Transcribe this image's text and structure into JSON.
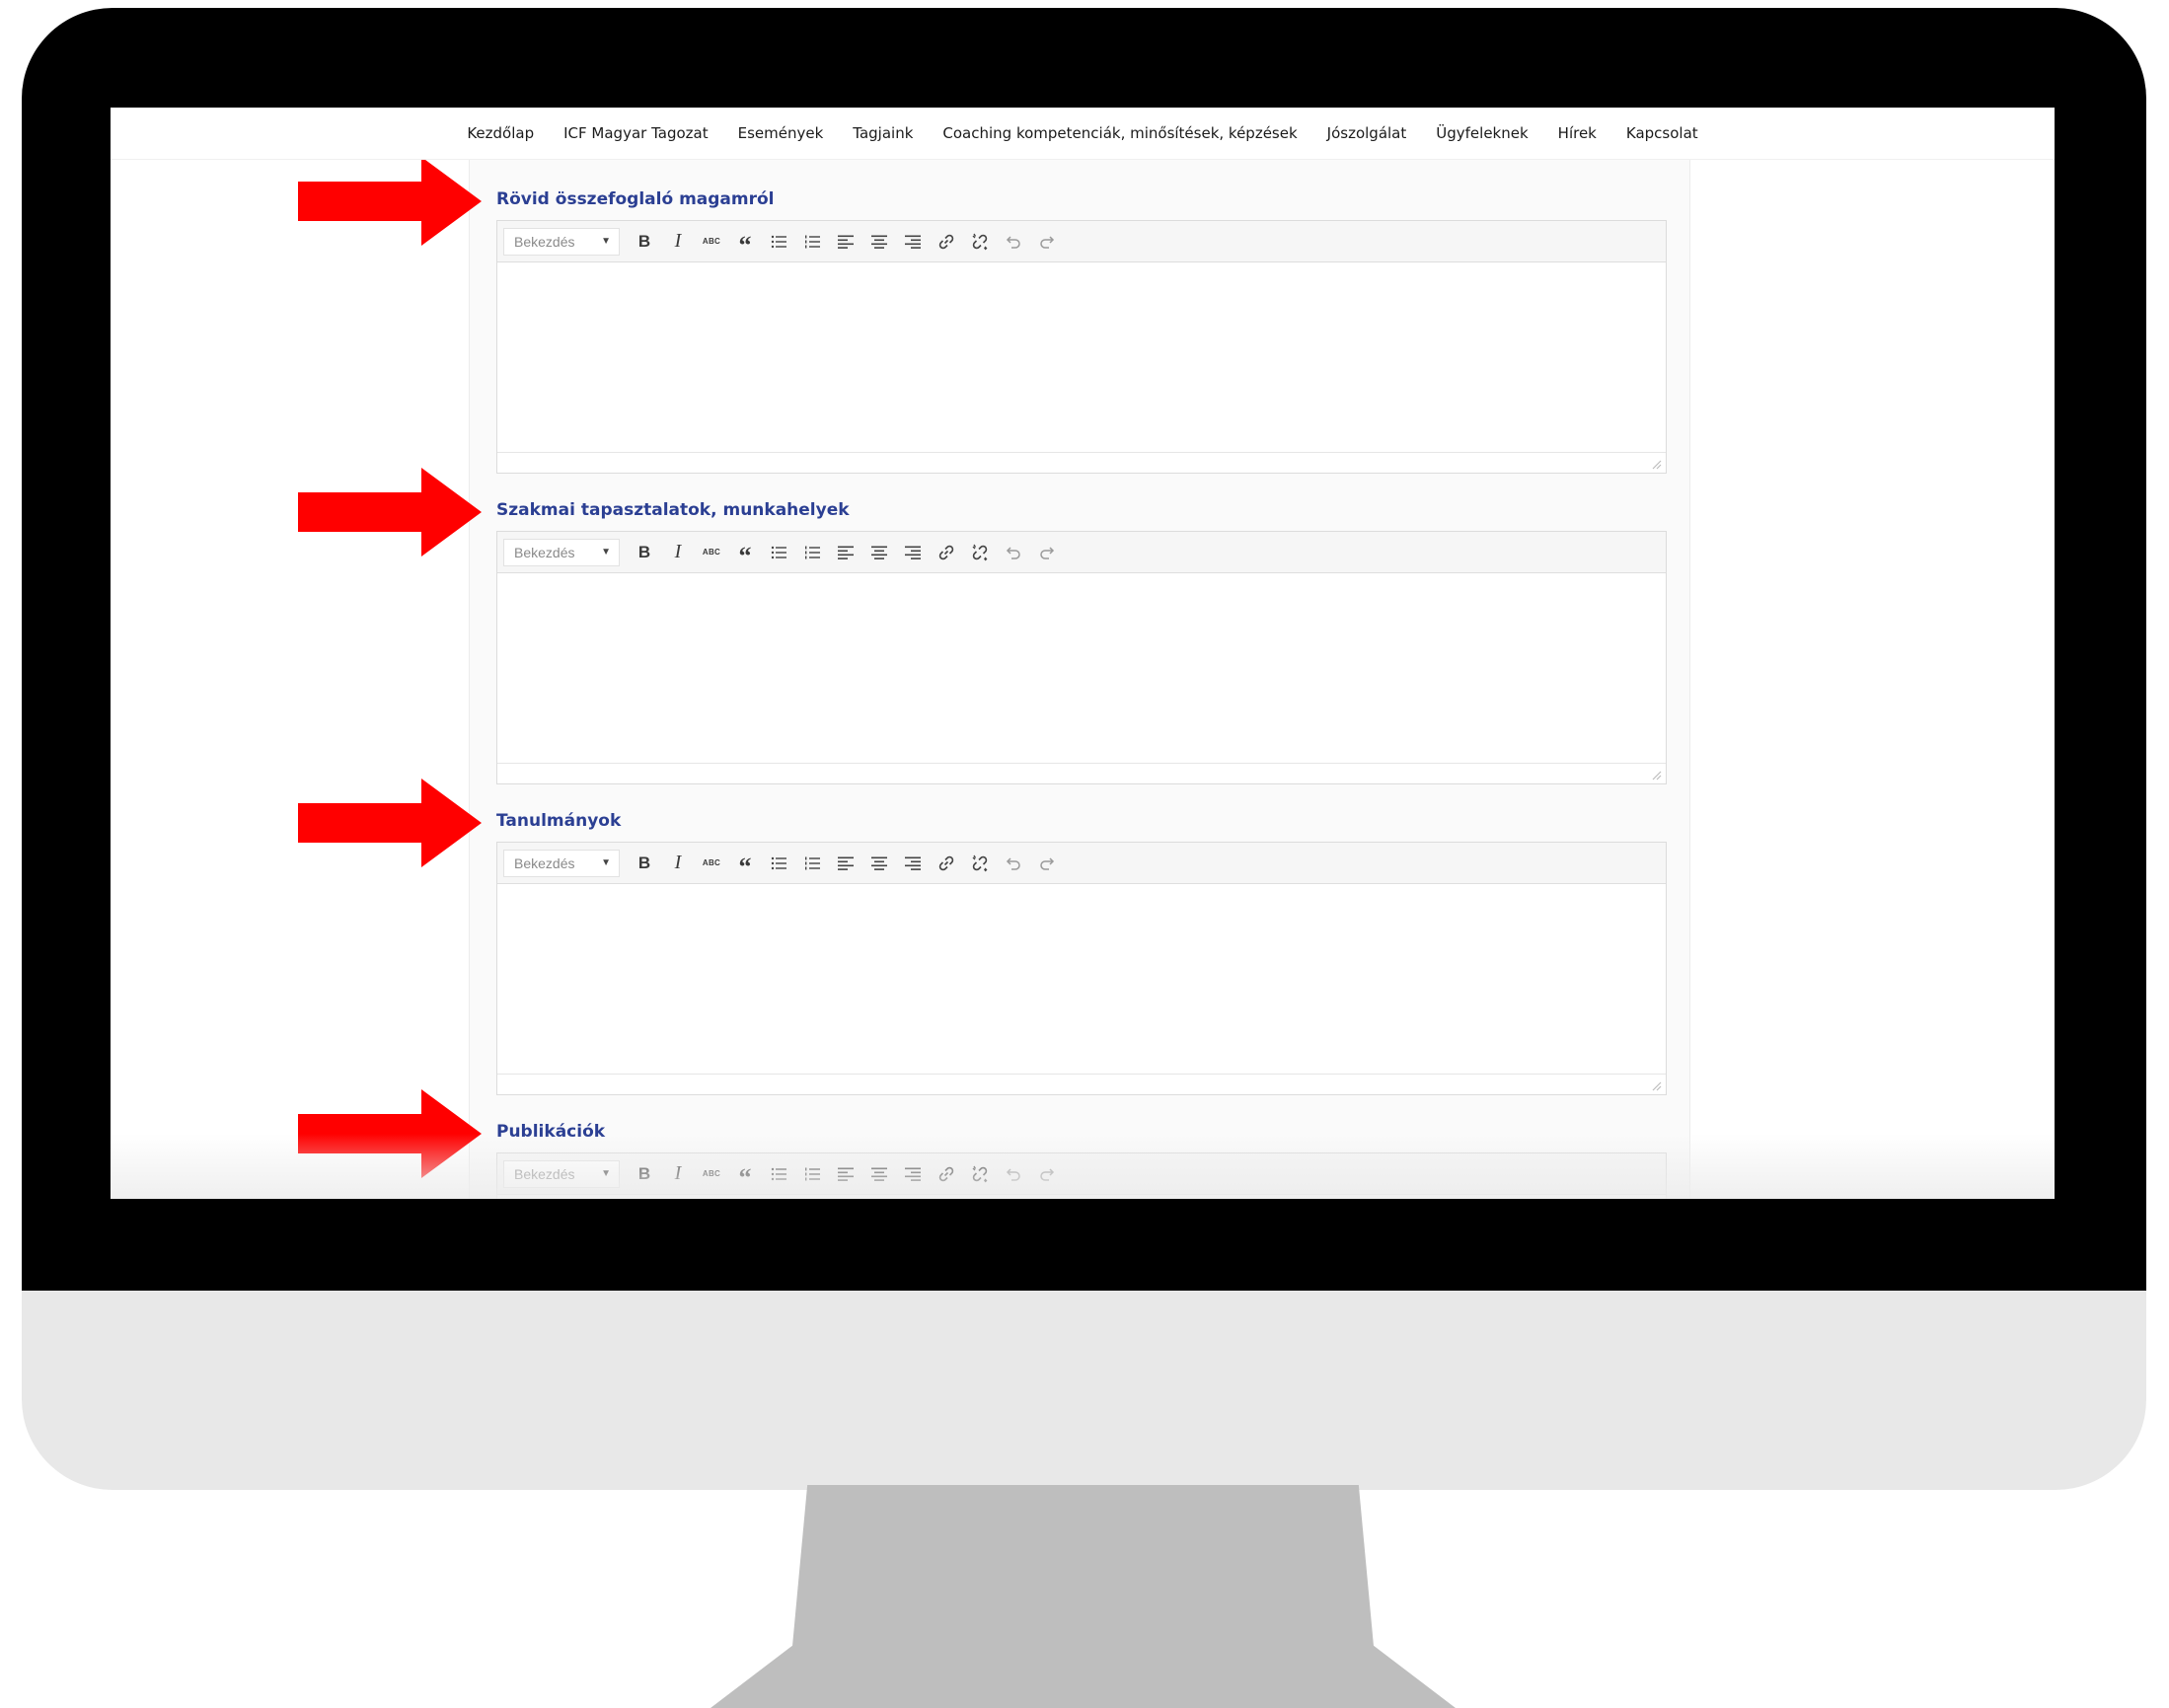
{
  "nav": {
    "items": [
      "Kezdőlap",
      "ICF Magyar Tagozat",
      "Események",
      "Tagjaink",
      "Coaching kompetenciák, minősítések, képzések",
      "Jószolgálat",
      "Ügyfeleknek",
      "Hírek",
      "Kapcsolat"
    ]
  },
  "sections": [
    {
      "label": "Rövid összefoglaló magamról",
      "format": "Bekezdés"
    },
    {
      "label": "Szakmai tapasztalatok, munkahelyek",
      "format": "Bekezdés"
    },
    {
      "label": "Tanulmányok",
      "format": "Bekezdés"
    },
    {
      "label": "Publikációk",
      "format": "Bekezdés"
    }
  ],
  "toolbar": {
    "bold": "B",
    "italic": "I",
    "strikethrough": "ABC",
    "blockquote": "“",
    "icons": [
      "bold-icon",
      "italic-icon",
      "strikethrough-icon",
      "blockquote-icon",
      "bullet-list-icon",
      "numbered-list-icon",
      "align-left-icon",
      "align-center-icon",
      "align-right-icon",
      "link-icon",
      "unlink-icon",
      "undo-icon",
      "redo-icon"
    ]
  },
  "colors": {
    "section_label": "#2b3f93",
    "arrow": "#ff0000",
    "monitor_bezel": "#000000",
    "monitor_chin": "#e8e8e8",
    "stand": "#bebebe"
  }
}
